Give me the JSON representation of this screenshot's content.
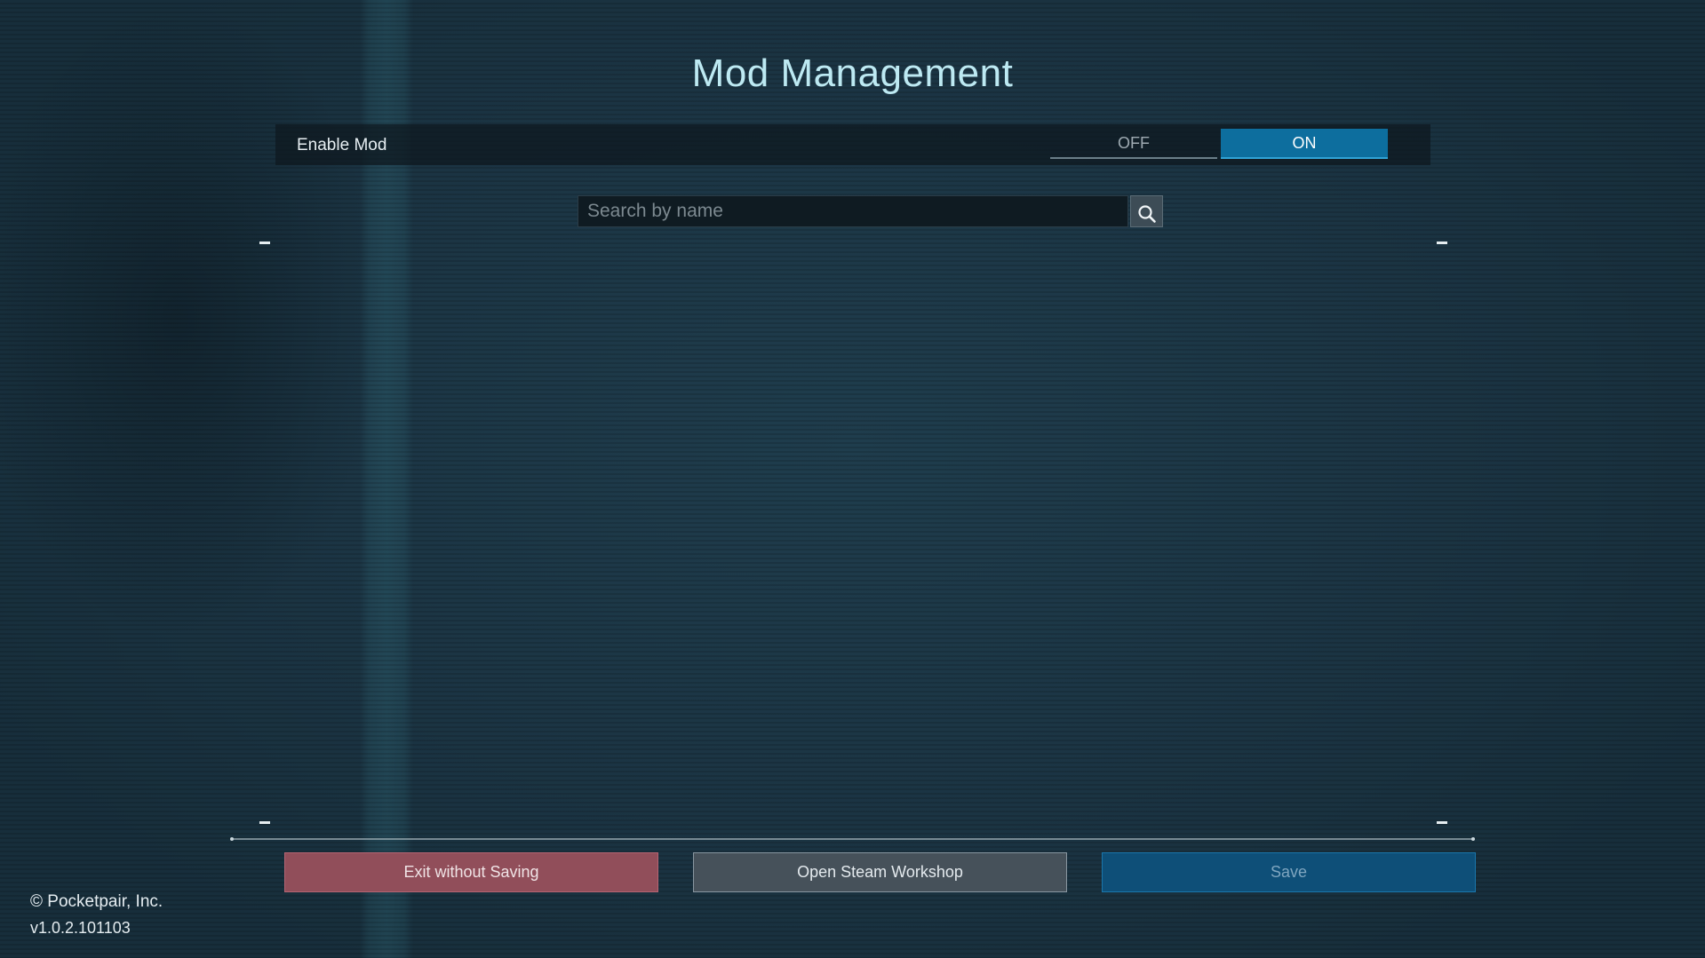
{
  "header": {
    "title": "Mod Management"
  },
  "enable_mod": {
    "label": "Enable Mod",
    "off_label": "OFF",
    "on_label": "ON",
    "selected": "ON"
  },
  "search": {
    "placeholder": "Search by name",
    "value": "",
    "icon": "search-icon"
  },
  "footer_buttons": {
    "exit_label": "Exit without Saving",
    "workshop_label": "Open Steam Workshop",
    "save_label": "Save"
  },
  "footer_info": {
    "copyright": "© Pocketpair, Inc.",
    "version": "v1.0.2.101103"
  },
  "colors": {
    "accent_on": "#0d6e9e",
    "exit_button": "#914e5a",
    "title_text": "#bde9f2"
  }
}
